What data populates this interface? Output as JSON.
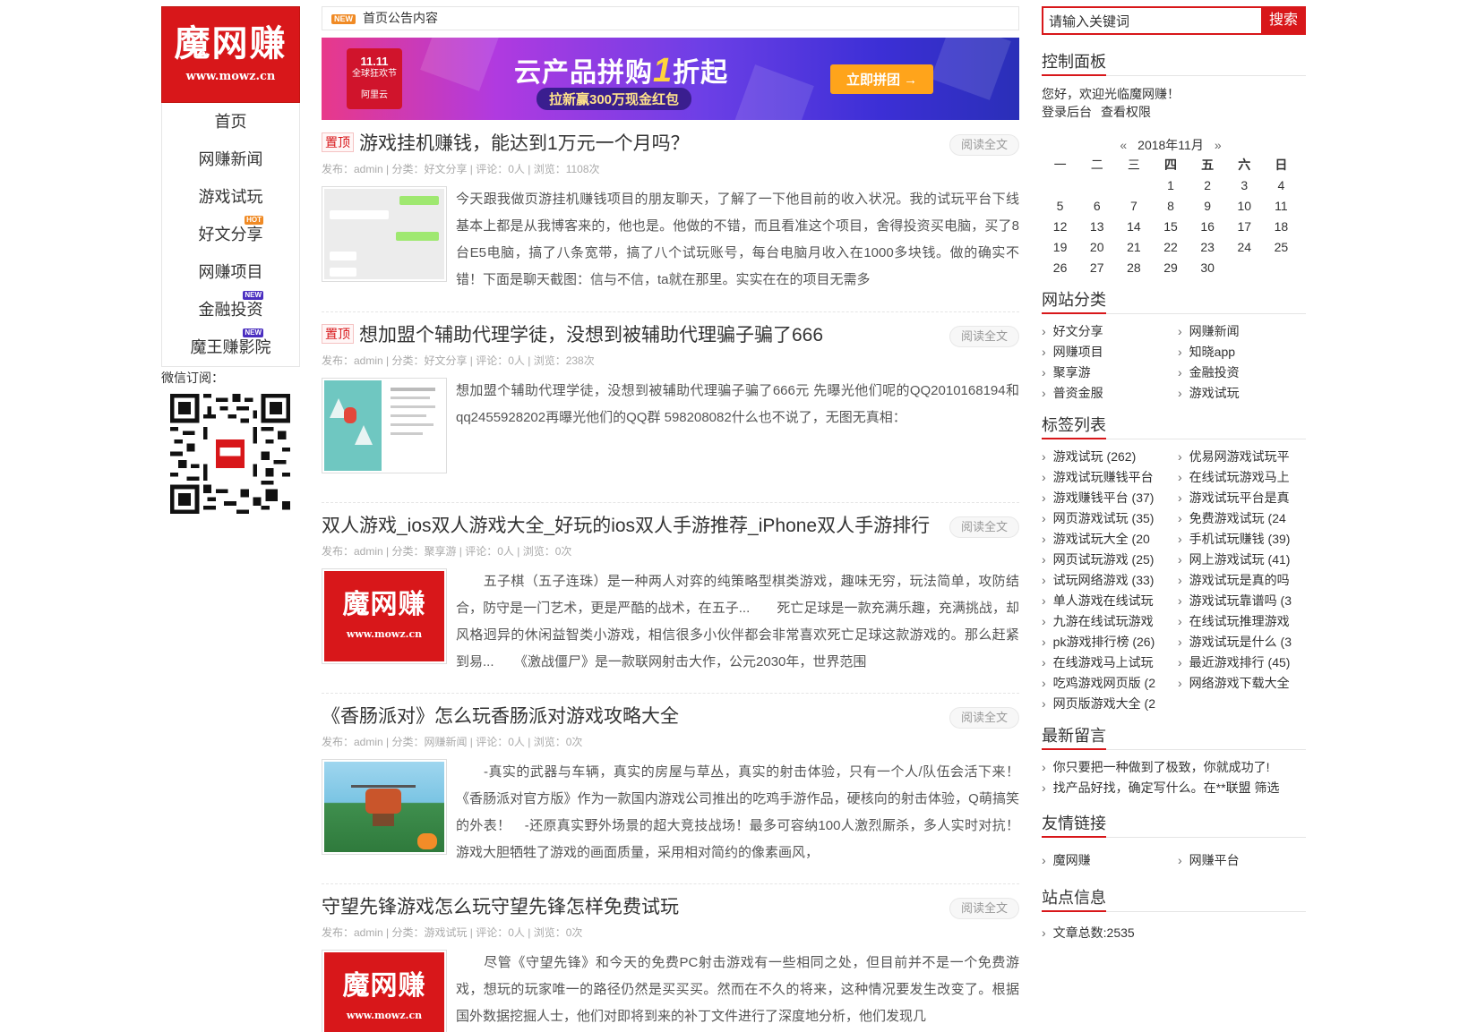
{
  "logo": {
    "text": "魔网赚",
    "url": "www.mowz.cn"
  },
  "nav": [
    {
      "label": "首页",
      "badge": ""
    },
    {
      "label": "网赚新闻",
      "badge": ""
    },
    {
      "label": "游戏试玩",
      "badge": ""
    },
    {
      "label": "好文分享",
      "badge": "HOT"
    },
    {
      "label": "网赚项目",
      "badge": ""
    },
    {
      "label": "金融投资",
      "badge": "NEW"
    },
    {
      "label": "魔王赚影院",
      "badge": "NEW"
    }
  ],
  "wechat_label": "微信订阅：",
  "notice": {
    "tag": "NEW",
    "text": "首页公告内容"
  },
  "banner": {
    "badge_line1": "11.11",
    "badge_line2": "全球狂欢节",
    "brand": "阿里云",
    "title_pre": "云产品拼购",
    "title_num": "1",
    "title_post": "折起",
    "subtitle": "拉新赢300万现金红包",
    "button": "立即拼团 →"
  },
  "posts": [
    {
      "top": "置顶",
      "title": "游戏挂机赚钱，能达到1万元一个月吗？",
      "meta": "发布：admin | 分类：好文分享 | 评论：0人 | 浏览：1108次",
      "read": "阅读全文",
      "thumb": "chat",
      "excerpt": "今天跟我做页游挂机赚钱项目的朋友聊天，了解了一下他目前的收入状况。我的试玩平台下线基本上都是从我博客来的，他也是。他做的不错，而且看准这个项目，舍得投资买电脑，买了8台E5电脑，搞了八条宽带，搞了八个试玩账号，每台电脑月收入在1000多块钱。做的确实不错！下面是聊天截图：信与不信，ta就在那里。实实在在的项目无需多"
    },
    {
      "top": "置顶",
      "title": "想加盟个辅助代理学徒，没想到被辅助代理骗子骗了666",
      "meta": "发布：admin | 分类：好文分享 | 评论：0人 | 浏览：238次",
      "read": "阅读全文",
      "thumb": "snow",
      "excerpt": "想加盟个辅助代理学徒，没想到被辅助代理骗子骗了666元 先曝光他们呢的QQ2010168194和qq2455928202再曝光他们的QQ群 598208082什么也不说了，无图无真相："
    },
    {
      "top": "",
      "title": "双人游戏_ios双人游戏大全_好玩的ios双人手游推荐_iPhone双人手游排行",
      "meta": "发布：admin | 分类：聚享游 | 评论：0人 | 浏览：0次",
      "read": "阅读全文",
      "thumb": "logo",
      "excerpt": "　　五子棋（五子连珠）是一种两人对弈的纯策略型棋类游戏，趣味无穷，玩法简单，攻防结合，防守是一门艺术，更是严酷的战术，在五子...　　死亡足球是一款充满乐趣，充满挑战，却风格迥异的休闲益智类小游戏，相信很多小伙伴都会非常喜欢死亡足球这款游戏的。那么赶紧到易...　　《激战僵尸》是一款联网射击大作，公元2030年，世界范围"
    },
    {
      "top": "",
      "title": "《香肠派对》怎么玩香肠派对游戏攻略大全",
      "meta": "发布：admin | 分类：网赚新闻 | 评论：0人 | 浏览：0次",
      "read": "阅读全文",
      "thumb": "game",
      "excerpt": "　　-真实的武器与车辆，真实的房屋与草丛，真实的射击体验，只有一个人/队伍会活下来！　《香肠派对官方版》作为一款国内游戏公司推出的吃鸡手游作品，硬核向的射击体验，Q萌搞笑的外表！　-还原真实野外场景的超大竞技战场！最多可容纳100人激烈厮杀，多人实时对抗！　游戏大胆牺牲了游戏的画面质量，采用相对简约的像素画风，"
    },
    {
      "top": "",
      "title": "守望先锋游戏怎么玩守望先锋怎样免费试玩",
      "meta": "发布：admin | 分类：游戏试玩 | 评论：0人 | 浏览：0次",
      "read": "阅读全文",
      "thumb": "logo",
      "excerpt": "　　尽管《守望先锋》和今天的免费PC射击游戏有一些相同之处，但目前并不是一个免费游戏，想玩的玩家唯一的路径仍然是买买买。然而在不久的将来，这种情况要发生改变了。根据国外数据挖掘人士，他们对即将到来的补丁文件进行了深度地分析，他们发现几"
    }
  ],
  "search": {
    "placeholder": "请输入关键词",
    "button": "搜索"
  },
  "control": {
    "title": "控制面板",
    "welcome": "您好，欢迎光临魔网赚！",
    "login": "登录后台",
    "perm": "查看权限"
  },
  "calendar": {
    "prev": "«",
    "month": "2018年11月",
    "next": "»",
    "weekdays": [
      "一",
      "二",
      "三",
      "四",
      "五",
      "六",
      "日"
    ],
    "days": [
      "",
      "",
      "",
      "1",
      "2",
      "3",
      "4",
      "5",
      "6",
      "7",
      "8",
      "9",
      "10",
      "11",
      "12",
      "13",
      "14",
      "15",
      "16",
      "17",
      "18",
      "19",
      "20",
      "21",
      "22",
      "23",
      "24",
      "25",
      "26",
      "27",
      "28",
      "29",
      "30",
      "",
      ""
    ]
  },
  "categories": {
    "title": "网站分类",
    "items": [
      "好文分享",
      "网赚新闻",
      "网赚项目",
      "知晓app",
      "聚享游",
      "金融投资",
      "普资金服",
      "游戏试玩"
    ]
  },
  "tags": {
    "title": "标签列表",
    "items": [
      "游戏试玩 (262)",
      "优易网游戏试玩平",
      "游戏试玩赚钱平台",
      "在线试玩游戏马上",
      "游戏赚钱平台 (37)",
      "游戏试玩平台是真",
      "网页游戏试玩 (35)",
      "免费游戏试玩 (24",
      "游戏试玩大全 (20",
      "手机试玩赚钱 (39)",
      "网页试玩游戏 (25)",
      "网上游戏试玩 (41)",
      "试玩网络游戏 (33)",
      "游戏试玩是真的吗",
      "单人游戏在线试玩",
      "游戏试玩靠谱吗 (3",
      "九游在线试玩游戏",
      "在线试玩推理游戏",
      "pk游戏排行榜 (26)",
      "游戏试玩是什么 (3",
      "在线游戏马上试玩",
      "最近游戏排行 (45)",
      "吃鸡游戏网页版 (2",
      "网络游戏下载大全",
      "网页版游戏大全 (2"
    ]
  },
  "comments": {
    "title": "最新留言",
    "items": [
      "你只要把一种做到了极致，你就成功了!",
      "找产品好找，确定写什么。在**联盟 筛选"
    ]
  },
  "links": {
    "title": "友情链接",
    "items": [
      "魔网赚",
      "网赚平台"
    ]
  },
  "siteinfo": {
    "title": "站点信息",
    "items": [
      "文章总数:2535"
    ]
  },
  "colors": {
    "brand": "#d8171a",
    "hot": "#f08a24",
    "new": "#4b2fc0"
  }
}
